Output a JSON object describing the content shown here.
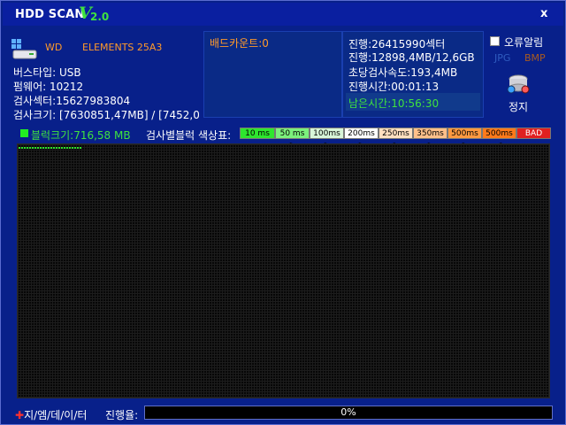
{
  "window": {
    "title": "HDD SCAN",
    "version_v": "V",
    "version_num": "2.0",
    "close_label": "x"
  },
  "drive": {
    "name_prefix": "WD",
    "model": "ELEMENTS 25A3",
    "bus": "버스타입: USB",
    "firmware": "펌웨어: 10212",
    "sectors": "검사섹터:15627983804",
    "size": "검사크기: [7630851,47MB] / [7452,0GI"
  },
  "bad": {
    "label": "배드카운트:0"
  },
  "progress_info": {
    "sector_progress": "진행:26415990섹터",
    "size_progress": "진행:12898,4MB/12,6GB",
    "speed": "초당검사속도:193,4MB",
    "elapsed": "진행시간:00:01:13",
    "remaining": "남은시간:10:56:30"
  },
  "options": {
    "error_alert": "오류알림",
    "jpg": "JPG",
    "bmp": "BMP",
    "stop": "정지"
  },
  "legend": {
    "block_size": "블럭크기:716,58 MB",
    "color_table_label": "검사별블럭 색상표:",
    "keys": [
      {
        "label": "10 ms",
        "color": "#2ee62e"
      },
      {
        "label": "50 ms >",
        "color": "#7cf07c"
      },
      {
        "label": "100ms >",
        "color": "#d8f5d8"
      },
      {
        "label": "200ms >",
        "color": "#ffffff"
      },
      {
        "label": "250ms >",
        "color": "#ffe0c0"
      },
      {
        "label": "350ms >",
        "color": "#ffc08a"
      },
      {
        "label": "500ms >",
        "color": "#ff9a40"
      },
      {
        "label": "500ms <",
        "color": "#ff7a1a"
      },
      {
        "label": "BAD",
        "color": "#e02020"
      }
    ]
  },
  "footer": {
    "brand": "지/엠/데/이/터",
    "progress_label": "진행율:",
    "percent_text": "0%",
    "percent_value": 0
  }
}
